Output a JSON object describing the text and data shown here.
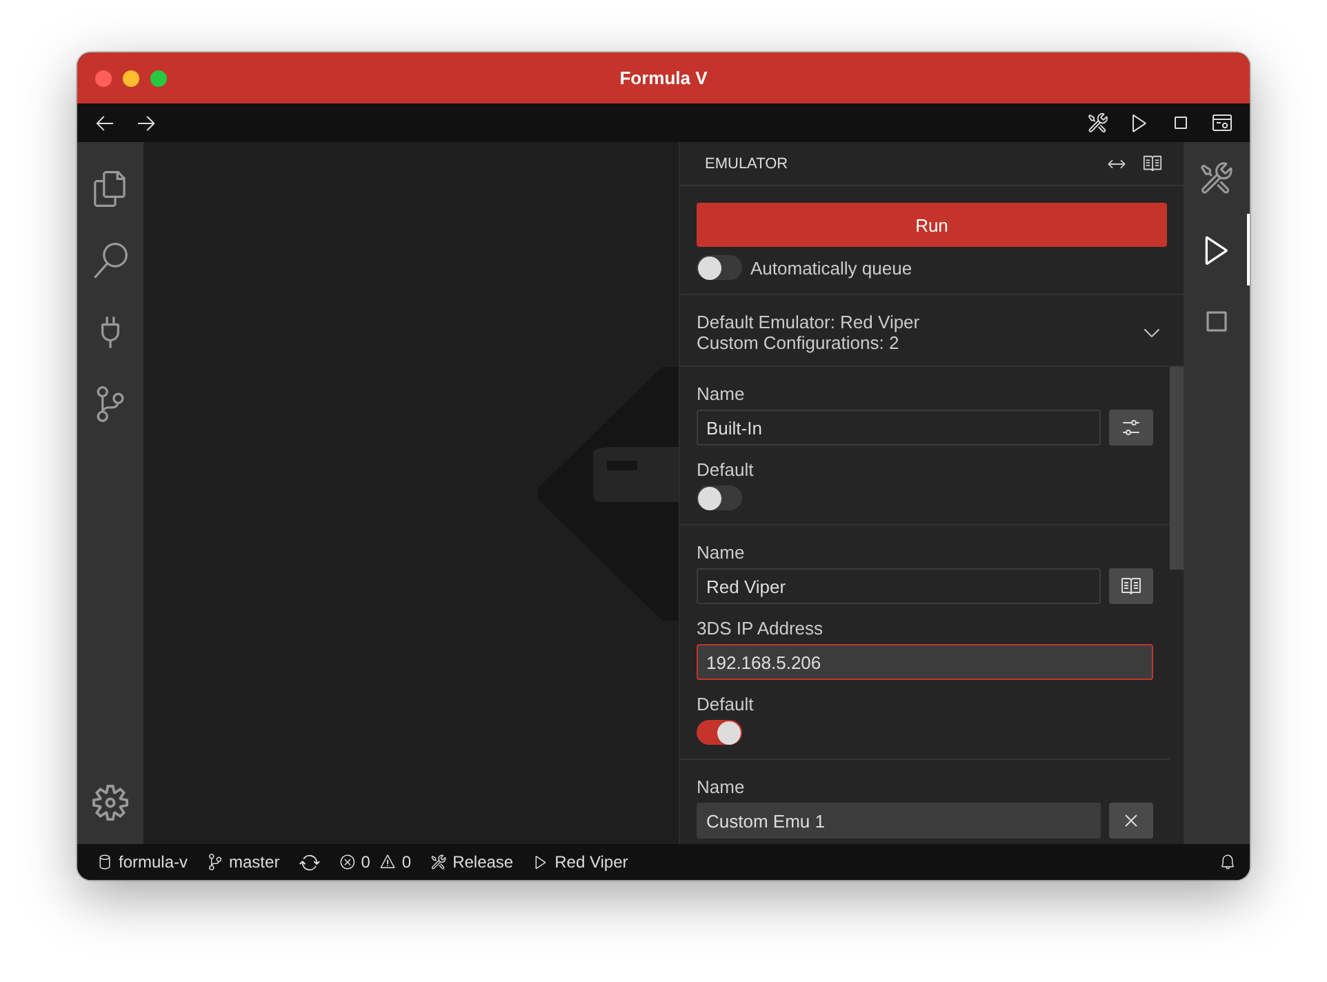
{
  "window": {
    "title": "Formula V"
  },
  "toolbar": {
    "right_tools": [
      {
        "kind": "tools",
        "selected": false
      },
      {
        "kind": "run",
        "selected": false
      },
      {
        "kind": "panel",
        "selected": false
      },
      {
        "kind": "layout",
        "selected": false
      }
    ]
  },
  "activity_bar": [
    {
      "kind": "files"
    },
    {
      "kind": "search"
    },
    {
      "kind": "extensions"
    },
    {
      "kind": "source_control"
    },
    {
      "kind": "settings"
    }
  ],
  "panel": {
    "title": "EMULATOR",
    "run_button": "Run",
    "auto_queue": {
      "label": "Automatically queue",
      "on": false
    },
    "summary": {
      "lines": [
        "Default Emulator: Red Viper",
        "Custom Configurations: 2"
      ],
      "expanded": false
    },
    "configurations": [
      {
        "name_label": "Name",
        "name": "Built-In",
        "editable": false,
        "kind": "settings",
        "default_label": "Default",
        "default": false
      },
      {
        "name_label": "Name",
        "name": "Red Viper",
        "editable": false,
        "kind": "docs",
        "fields": [
          {
            "label": "3DS IP Address",
            "value": "192.168.5.206",
            "focused": true
          }
        ],
        "default_label": "Default",
        "default": true
      },
      {
        "name_label": "Name",
        "name": "Custom Emu 1",
        "editable": true,
        "kind": "remove"
      }
    ]
  },
  "right_activity_bar": [
    {
      "kind": "tools",
      "selected": false
    },
    {
      "kind": "run",
      "selected": true
    },
    {
      "kind": "panel",
      "selected": false
    }
  ],
  "status_bar": {
    "items": [
      {
        "kind": "project",
        "text": "formula-v"
      },
      {
        "kind": "branch",
        "text": "master"
      },
      {
        "kind": "sync"
      },
      {
        "kind": "problems",
        "errors": "0",
        "warnings": "0"
      },
      {
        "kind": "build",
        "text": "Release"
      },
      {
        "kind": "emulator",
        "text": "Red Viper"
      }
    ],
    "notifications": {
      "kind": "bell"
    }
  }
}
